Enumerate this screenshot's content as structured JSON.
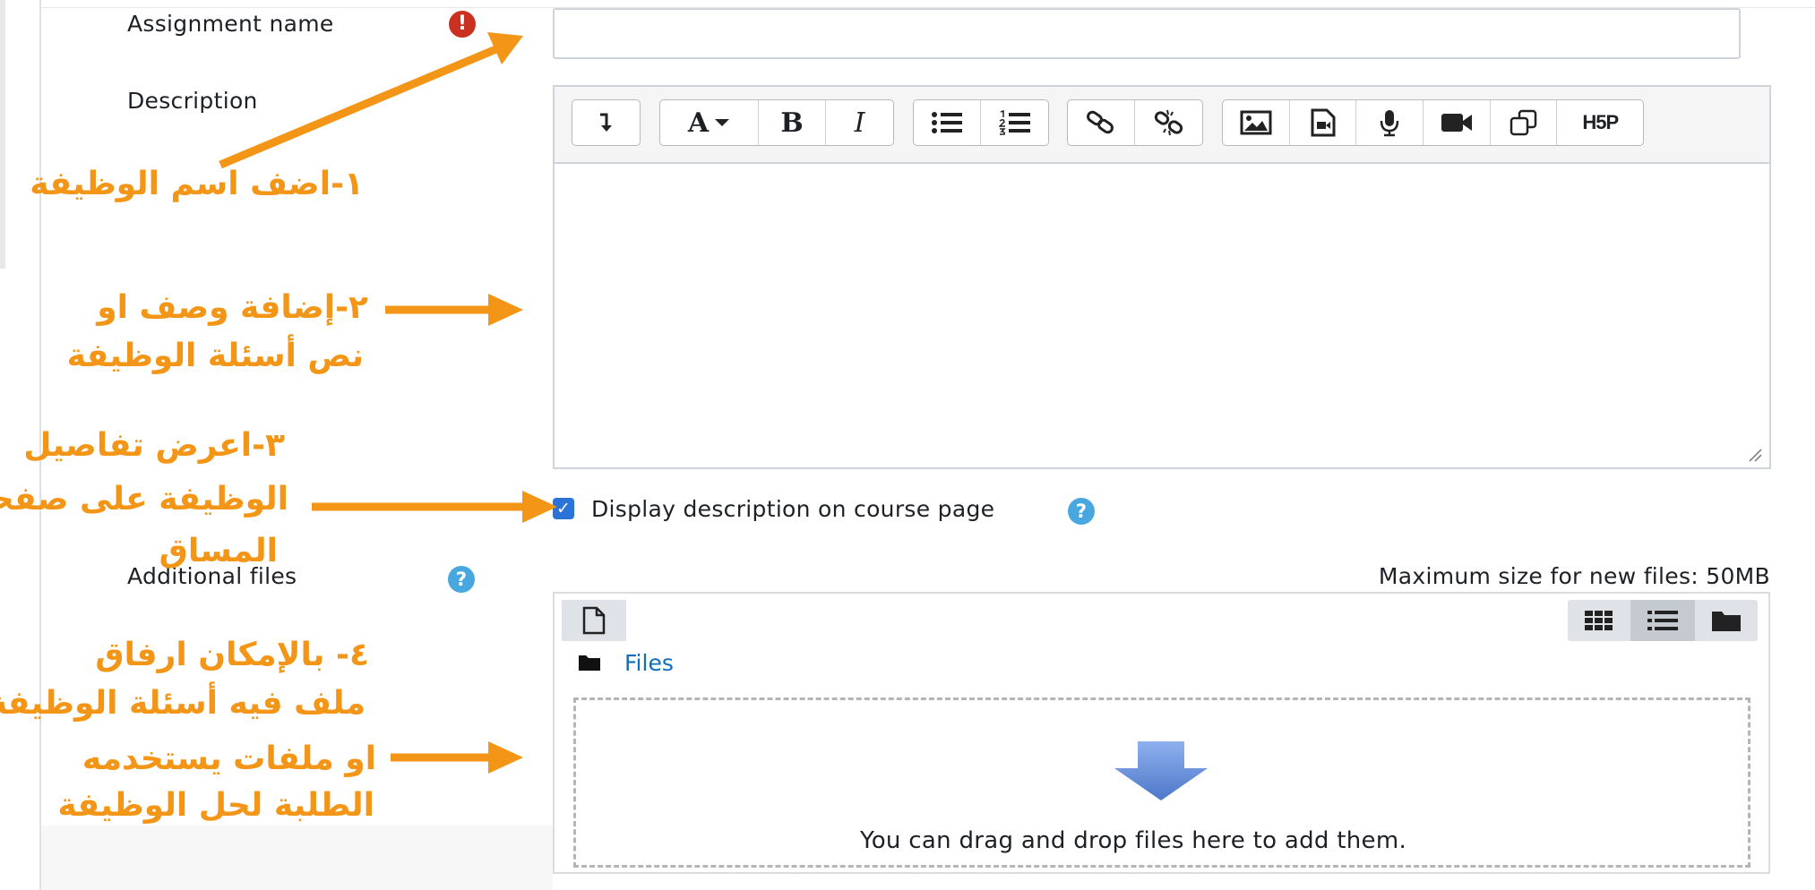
{
  "form": {
    "assignment_name_label": "Assignment name",
    "required_icon": "!",
    "assignment_name_value": "",
    "description_label": "Description",
    "display_description_label": "Display description on course page",
    "display_description_checked": true,
    "help_icon": "?",
    "additional_files_label": "Additional files",
    "max_size_text": "Maximum size for new files: 50MB"
  },
  "editor_toolbar": {
    "bold_glyph": "B",
    "italic_glyph": "I",
    "font_glyph": "A",
    "h5p_text": "H5P",
    "buttons": [
      "collapse-toolbar",
      "font-style",
      "bold",
      "italic",
      "bullet-list",
      "numbered-list",
      "link",
      "unlink",
      "insert-image",
      "insert-media",
      "record-audio",
      "record-video",
      "manage-files",
      "insert-h5p"
    ]
  },
  "filepicker": {
    "breadcrumb_folder": "Files",
    "drop_text": "You can drag and drop files here to add them.",
    "view_modes": [
      "icons",
      "list",
      "tree"
    ],
    "active_view": "list"
  },
  "annotations": {
    "step1": "١-اضف اسم الوظيفة",
    "step2_line1": "٢-إضافة وصف او",
    "step2_line2": "نص أسئلة الوظيفة",
    "step3_line1": "٣-اعرض تفاصيل",
    "step3_line2": "الوظيفة على صفحة",
    "step3_line3": "المساق",
    "step4_line1": "٤- بالإمكان ارفاق",
    "step4_line2": "ملف فيه أسئلة الوظيفة",
    "step4_line3": "او ملفات يستخدمه",
    "step4_line4": "الطلبة لحل الوظيفة"
  },
  "colors": {
    "annotation_orange": "#f39516",
    "required_red": "#ca3120",
    "help_blue": "#49a7e0",
    "link_blue": "#0f6cbf",
    "checkbox_blue": "#2a73d9"
  }
}
